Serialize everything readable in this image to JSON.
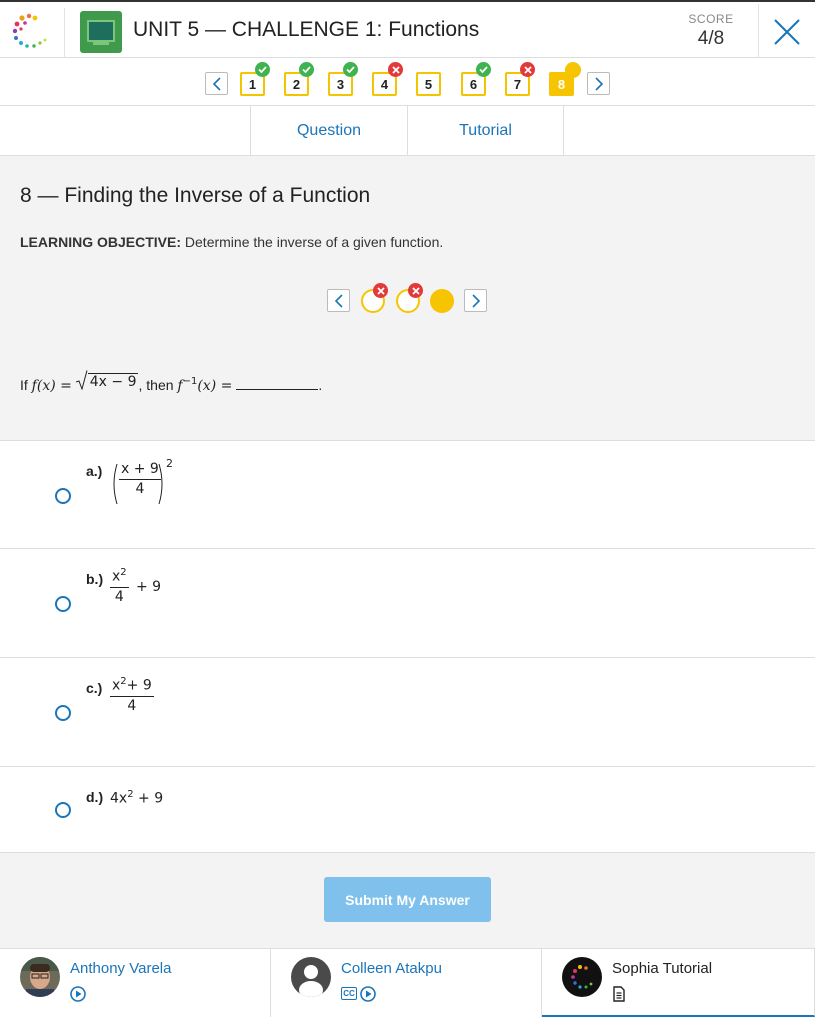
{
  "header": {
    "title": "UNIT 5 — CHALLENGE 1: Functions",
    "score_label": "SCORE",
    "score_value": "4/8"
  },
  "question_nav": {
    "questions": [
      {
        "number": "1",
        "status": "correct"
      },
      {
        "number": "2",
        "status": "correct"
      },
      {
        "number": "3",
        "status": "correct"
      },
      {
        "number": "4",
        "status": "incorrect"
      },
      {
        "number": "5",
        "status": "unanswered"
      },
      {
        "number": "6",
        "status": "correct"
      },
      {
        "number": "7",
        "status": "incorrect"
      },
      {
        "number": "8",
        "status": "current"
      }
    ]
  },
  "tabs": [
    {
      "label": "Question"
    },
    {
      "label": "Tutorial"
    }
  ],
  "question": {
    "title": "8 — Finding the Inverse of a Function",
    "objective_label": "LEARNING OBJECTIVE:",
    "objective_text": "Determine the inverse of a given function.",
    "attempts": [
      "incorrect",
      "incorrect",
      "current"
    ],
    "stem": {
      "prefix": "If",
      "f_of_x": "f(x) =",
      "radicand": "4x − 9",
      "then": ", then",
      "f_inverse": "f",
      "inverse_exp": "−1",
      "of_x_eq": "(x) =",
      "end": "."
    }
  },
  "answers": [
    {
      "letter": "a.)",
      "numerator": "x + 9",
      "denominator": "4",
      "outer_exponent": "2"
    },
    {
      "letter": "b.)",
      "numerator_base": "x",
      "numerator_exp": "2",
      "denominator": "4",
      "tail": "+ 9"
    },
    {
      "letter": "c.)",
      "numerator_base": "x",
      "numerator_exp": "2",
      "numerator_tail": "+ 9",
      "denominator": "4"
    },
    {
      "letter": "d.)",
      "base": "4x",
      "exponent": "2",
      "tail": "+ 9"
    }
  ],
  "submit": {
    "label": "Submit My Answer"
  },
  "tutors": [
    {
      "name": "Anthony Varela"
    },
    {
      "name": "Colleen Atakpu",
      "cc_label": "CC"
    },
    {
      "name": "Sophia Tutorial"
    }
  ],
  "colors": {
    "accent_blue": "#1b75b9",
    "nav_yellow": "#f6c400",
    "correct_green": "#3fb34f",
    "incorrect_red": "#e23a3a",
    "submit_disabled": "#7fc0ec"
  }
}
